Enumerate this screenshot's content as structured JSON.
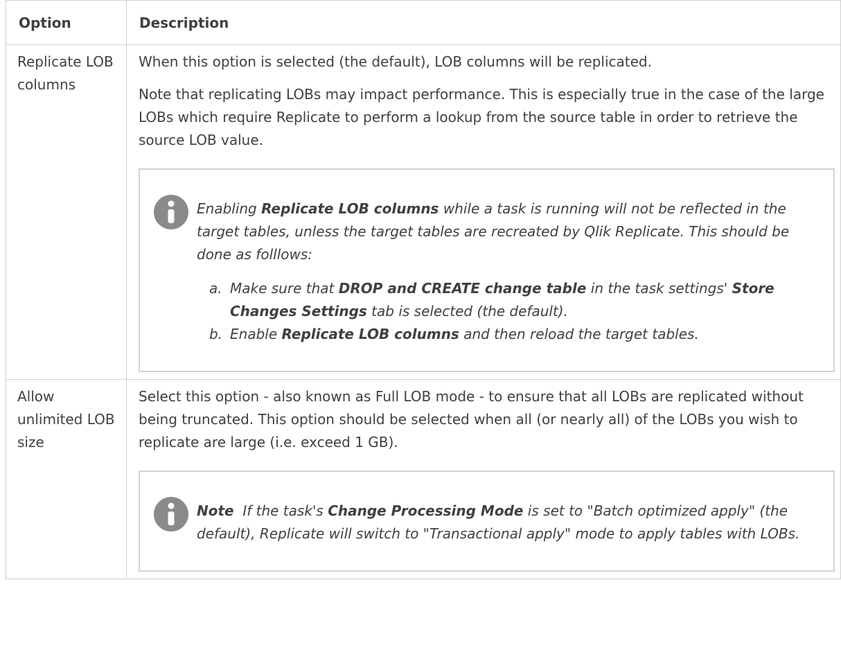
{
  "table": {
    "headers": {
      "option": "Option",
      "description": "Description"
    },
    "rows": [
      {
        "option_label": "Replicate LOB columns",
        "para1": "When this option is selected (the default), LOB columns will be replicated.",
        "para2": "Note that replicating LOBs may impact performance. This is especially true in the case of the large LOBs which require Replicate to perform a lookup from the source table in order to retrieve the source LOB value.",
        "note": {
          "icon": "info-icon",
          "intro_prefix": "Enabling ",
          "intro_bold": "Replicate LOB columns",
          "intro_suffix": " while a task is running will not be reflected in the target tables, unless the target tables are recreated by Qlik Replicate. This should be done as folllows:",
          "steps": [
            {
              "marker": "a.",
              "t1": "Make sure that ",
              "b1": "DROP and CREATE change table",
              "t2": " in the task settings' ",
              "b2": "Store Changes Settings",
              "t3": " tab is selected (the default)."
            },
            {
              "marker": "b.",
              "t1": "Enable ",
              "b1": "Replicate LOB columns",
              "t2": " and then reload the target tables."
            }
          ]
        }
      },
      {
        "option_label": "Allow unlimited LOB size",
        "para1": "Select this option - also known as Full LOB mode - to ensure that all LOBs are replicated without being truncated. This option should be selected when all (or nearly all) of the LOBs you wish to replicate are large (i.e. exceed 1 GB).",
        "note": {
          "icon": "info-icon",
          "label": "Note",
          "t1": "  If the task's ",
          "b1": "Change Processing Mode",
          "t2": " is set to \"Batch optimized apply\" (the default), Replicate will switch to \"Transactional apply\" mode to apply tables with LOBs."
        }
      }
    ]
  }
}
